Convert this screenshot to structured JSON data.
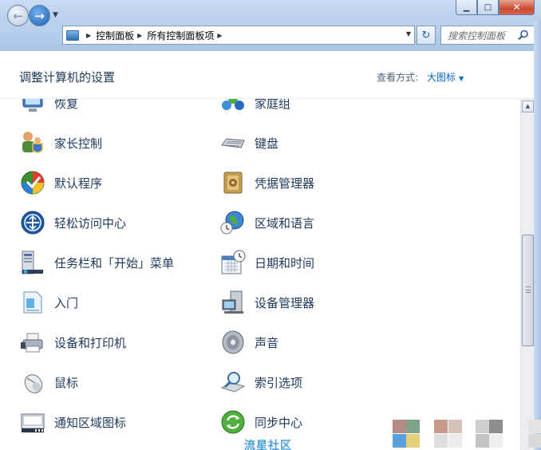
{
  "window": {
    "buttons": {
      "minimize": "▁",
      "maximize": "□",
      "close": "✕"
    }
  },
  "nav": {
    "back_icon": "←",
    "forward_icon": "→",
    "dropdown_icon": "▼",
    "breadcrumbs": [
      "控制面板",
      "所有控制面板项"
    ],
    "refresh_icon": "↻",
    "search_placeholder": "搜索控制面板"
  },
  "header": {
    "title": "调整计算机的设置",
    "view_by_label": "查看方式:",
    "view_by_value": "大图标"
  },
  "items_left": [
    {
      "label": "恢复",
      "icon": "recovery-icon"
    },
    {
      "label": "家长控制",
      "icon": "parental-controls-icon"
    },
    {
      "label": "默认程序",
      "icon": "default-programs-icon"
    },
    {
      "label": "轻松访问中心",
      "icon": "ease-of-access-icon"
    },
    {
      "label": "任务栏和「开始」菜单",
      "icon": "taskbar-icon"
    },
    {
      "label": "入门",
      "icon": "getting-started-icon"
    },
    {
      "label": "设备和打印机",
      "icon": "printer-icon"
    },
    {
      "label": "鼠标",
      "icon": "mouse-icon"
    },
    {
      "label": "通知区域图标",
      "icon": "notification-icon"
    }
  ],
  "items_right": [
    {
      "label": "家庭组",
      "icon": "homegroup-icon"
    },
    {
      "label": "键盘",
      "icon": "keyboard-icon"
    },
    {
      "label": "凭据管理器",
      "icon": "credential-manager-icon"
    },
    {
      "label": "区域和语言",
      "icon": "region-language-icon"
    },
    {
      "label": "日期和时间",
      "icon": "date-time-icon"
    },
    {
      "label": "设备管理器",
      "icon": "device-manager-icon"
    },
    {
      "label": "声音",
      "icon": "sound-icon"
    },
    {
      "label": "索引选项",
      "icon": "indexing-icon"
    },
    {
      "label": "同步中心",
      "icon": "sync-center-icon"
    }
  ],
  "watermark": "流星社区"
}
